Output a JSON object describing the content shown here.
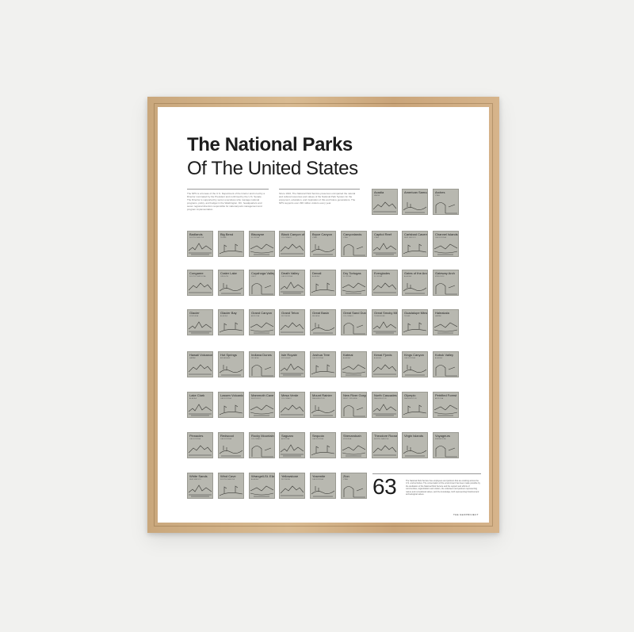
{
  "poster": {
    "title_bold": "The National Parks",
    "title_light": "Of The United States",
    "intro_left": "The NPS is a bureau of the U.S. Department of the Interior and is led by a Director nominated by the President and confirmed by the U.S. Senate. The Director is supported by senior executives who manage national programs, policy, and budget in the Washington, DC, headquarters and seven regional directors responsible for national park management and program implementation.",
    "intro_right": "Since 1916, The National Park Service preserves unimpaired the natural and cultural resources and values of the National Park System for the enjoyment, education, and inspiration of this and future generations. The NPS supports over 296 million visitors every year.",
    "count": "63",
    "footnote": "The National Park Service has employees and partners that are working across the U.S. and territories. The conservation of the environment has been made possible by the dedication of the National Park Service and the support and efforts of communities, organizations and visitors, the volunteers and partners representing nature and recreational values, and the knowledge, both representing historical and archeological values.",
    "credit": "THE GEOPROJECT",
    "tile_color": "#b8b8b0"
  },
  "parks": [
    {
      "name": "Acadia",
      "state": "MAINE"
    },
    {
      "name": "American Samoa",
      "state": ""
    },
    {
      "name": "Arches",
      "state": "UTAH"
    },
    {
      "name": "Badlands",
      "state": "SOUTH DAKOTA"
    },
    {
      "name": "Big Bend",
      "state": "TEXAS"
    },
    {
      "name": "Biscayne",
      "state": "FLORIDA"
    },
    {
      "name": "Black Canyon of the Gunnison",
      "state": "COLORADO"
    },
    {
      "name": "Bryce Canyon",
      "state": "UTAH"
    },
    {
      "name": "Canyonlands",
      "state": "UTAH"
    },
    {
      "name": "Capitol Reef",
      "state": "UTAH"
    },
    {
      "name": "Carlsbad Caverns",
      "state": "NEW MEXICO"
    },
    {
      "name": "Channel Islands",
      "state": "CALIFORNIA"
    },
    {
      "name": "Congaree",
      "state": "SOUTH CAROLINA"
    },
    {
      "name": "Crater Lake",
      "state": "OREGON"
    },
    {
      "name": "Cuyahoga Valley",
      "state": "OHIO"
    },
    {
      "name": "Death Valley",
      "state": "CALIFORNIA"
    },
    {
      "name": "Denali",
      "state": "ALASKA"
    },
    {
      "name": "Dry Tortugas",
      "state": "FLORIDA"
    },
    {
      "name": "Everglades",
      "state": "FLORIDA"
    },
    {
      "name": "Gates of the Arctic",
      "state": "ALASKA"
    },
    {
      "name": "Gateway Arch",
      "state": "MISSOURI"
    },
    {
      "name": "Glacier",
      "state": "MONTANA"
    },
    {
      "name": "Glacier Bay",
      "state": "ALASKA"
    },
    {
      "name": "Grand Canyon",
      "state": "ARIZONA"
    },
    {
      "name": "Grand Teton",
      "state": "WYOMING"
    },
    {
      "name": "Great Basin",
      "state": "NEVADA"
    },
    {
      "name": "Great Sand Dunes",
      "state": "COLORADO"
    },
    {
      "name": "Great Smoky Mtns",
      "state": "TENNESSEE"
    },
    {
      "name": "Guadalupe Mtns",
      "state": "TEXAS"
    },
    {
      "name": "Haleakala",
      "state": "HAWAII"
    },
    {
      "name": "Hawaii Volcanoes",
      "state": "HAWAII"
    },
    {
      "name": "Hot Springs",
      "state": "ARKANSAS"
    },
    {
      "name": "Indiana Dunes",
      "state": "INDIANA"
    },
    {
      "name": "Isle Royale",
      "state": "MICHIGAN"
    },
    {
      "name": "Joshua Tree",
      "state": "CALIFORNIA"
    },
    {
      "name": "Katmai",
      "state": "ALASKA"
    },
    {
      "name": "Kenai Fjords",
      "state": "ALASKA"
    },
    {
      "name": "Kings Canyon",
      "state": "CALIFORNIA"
    },
    {
      "name": "Kobuk Valley",
      "state": "ALASKA"
    },
    {
      "name": "Lake Clark",
      "state": "ALASKA"
    },
    {
      "name": "Lassen Volcanic",
      "state": "CALIFORNIA"
    },
    {
      "name": "Mammoth Cave",
      "state": "KENTUCKY"
    },
    {
      "name": "Mesa Verde",
      "state": "COLORADO"
    },
    {
      "name": "Mount Rainier",
      "state": "WASHINGTON"
    },
    {
      "name": "New River Gorge",
      "state": "WEST VIRGINIA"
    },
    {
      "name": "North Cascades",
      "state": "WASHINGTON"
    },
    {
      "name": "Olympic",
      "state": "WASHINGTON"
    },
    {
      "name": "Petrified Forest",
      "state": "ARIZONA"
    },
    {
      "name": "Pinnacles",
      "state": "CALIFORNIA"
    },
    {
      "name": "Redwood",
      "state": "CALIFORNIA"
    },
    {
      "name": "Rocky Mountain",
      "state": "COLORADO"
    },
    {
      "name": "Saguaro",
      "state": "ARIZONA"
    },
    {
      "name": "Sequoia",
      "state": "CALIFORNIA"
    },
    {
      "name": "Shenandoah",
      "state": "VIRGINIA"
    },
    {
      "name": "Theodore Roosevelt",
      "state": "NORTH DAKOTA"
    },
    {
      "name": "Virgin Islands",
      "state": ""
    },
    {
      "name": "Voyageurs",
      "state": "MINNESOTA"
    },
    {
      "name": "White Sands",
      "state": "NEW MEXICO"
    },
    {
      "name": "Wind Cave",
      "state": "SOUTH DAKOTA"
    },
    {
      "name": "Wrangell-St. Elias",
      "state": "ALASKA"
    },
    {
      "name": "Yellowstone",
      "state": "WYOMING"
    },
    {
      "name": "Yosemite",
      "state": "CALIFORNIA"
    },
    {
      "name": "Zion",
      "state": "UTAH"
    }
  ]
}
